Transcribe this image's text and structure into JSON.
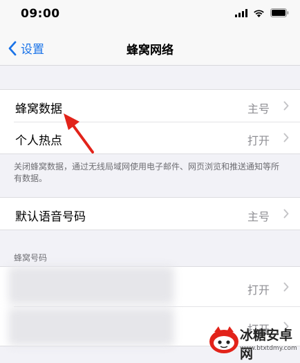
{
  "status_bar": {
    "time": "09:00"
  },
  "nav": {
    "back_label": "设置",
    "title": "蜂窝网络"
  },
  "group1": {
    "rows": [
      {
        "label": "蜂窝数据",
        "value": "主号"
      },
      {
        "label": "个人热点",
        "value": "打开"
      }
    ],
    "footer": "关闭蜂窝数据，通过无线局域网使用电子邮件、网页浏览和推送通知等所有数据。"
  },
  "group2": {
    "rows": [
      {
        "label": "默认语音号码",
        "value": "主号"
      }
    ]
  },
  "section": {
    "header": "蜂窝号码",
    "rows": [
      {
        "value": "打开"
      },
      {
        "value": "打开"
      }
    ]
  },
  "watermark": {
    "text": "冰糖安卓网",
    "url": "www.btxtdmy.com"
  },
  "colors": {
    "accent": "#1a73e8",
    "arrow": "#e2231a",
    "background": "#f2f2f7"
  }
}
